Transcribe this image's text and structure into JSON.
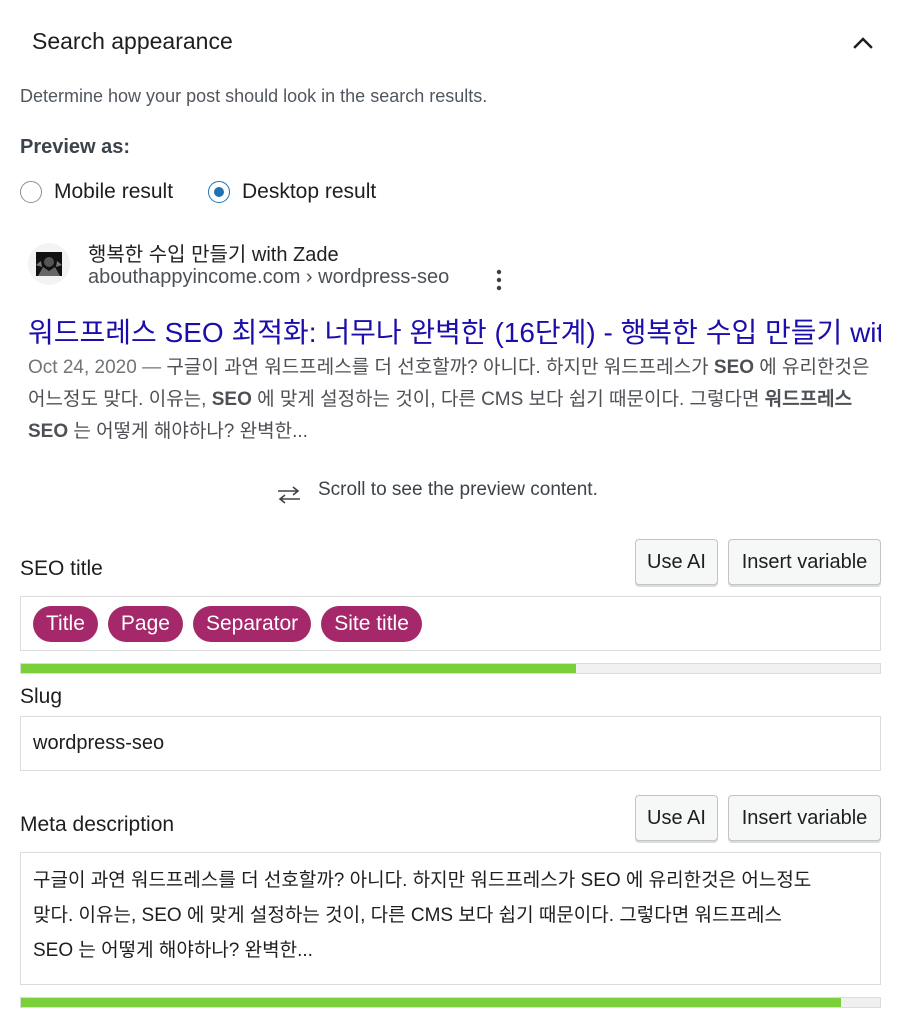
{
  "panel": {
    "title": "Search appearance",
    "description": "Determine how your post should look in the search results.",
    "preview_label": "Preview as:",
    "radio_options": [
      {
        "label": "Mobile result",
        "checked": false
      },
      {
        "label": "Desktop result",
        "checked": true
      }
    ]
  },
  "serp": {
    "site_name": "행복한 수입 만들기 with Zade",
    "site_url": "abouthappyincome.com › wordpress-seo",
    "title": "워드프레스 SEO 최적화: 너무나 완벽한 (16단계) - 행복한 수입 만들기 with Zade",
    "date": "Oct 24, 2020 — ",
    "snippet_line1": "구글이 과연 워드프레스를 더 선호할까? 아니다. 하지만 워드프레스가 ",
    "snippet_bold1": "SEO",
    "snippet_line1_end": " 에 유리한것은",
    "snippet_line2_a": "어느정도 맞다. 이유는, ",
    "snippet_bold2": "SEO",
    "snippet_line2_b": " 에 맞게 설정하는 것이, 다른 CMS 보다 쉽기 때문이다. 그렇다면 ",
    "snippet_bold3": "워드프레스",
    "snippet_bold4": "SEO",
    "snippet_line3": " 는 어떻게 해야하나? 완벽한..."
  },
  "scroll_hint": "Scroll to see the preview content.",
  "seo_title": {
    "label": "SEO title",
    "use_ai_label": "Use AI",
    "insert_variable_label": "Insert variable",
    "chips": [
      "Title",
      "Page",
      "Separator",
      "Site title"
    ],
    "progress": 0.646
  },
  "slug": {
    "label": "Slug",
    "value": "wordpress-seo"
  },
  "meta_description": {
    "label": "Meta description",
    "use_ai_label": "Use AI",
    "insert_variable_label": "Insert variable",
    "line1": "구글이 과연 워드프레스를 더 선호할까? 아니다. 하지만 워드프레스가 SEO 에 유리한것은 어느정도",
    "line2": "맞다. 이유는, SEO 에 맞게 설정하는 것이, 다른 CMS 보다 쉽기 때문이다. 그렇다면 워드프레스",
    "line3": "SEO 는 어떻게 해야하나? 완벽한...",
    "progress": 0.955
  },
  "colors": {
    "chip": "#a4286a",
    "progress_good": "#7ad03a",
    "serp_link": "#1a0dab",
    "radio_accent": "#2271b1"
  }
}
